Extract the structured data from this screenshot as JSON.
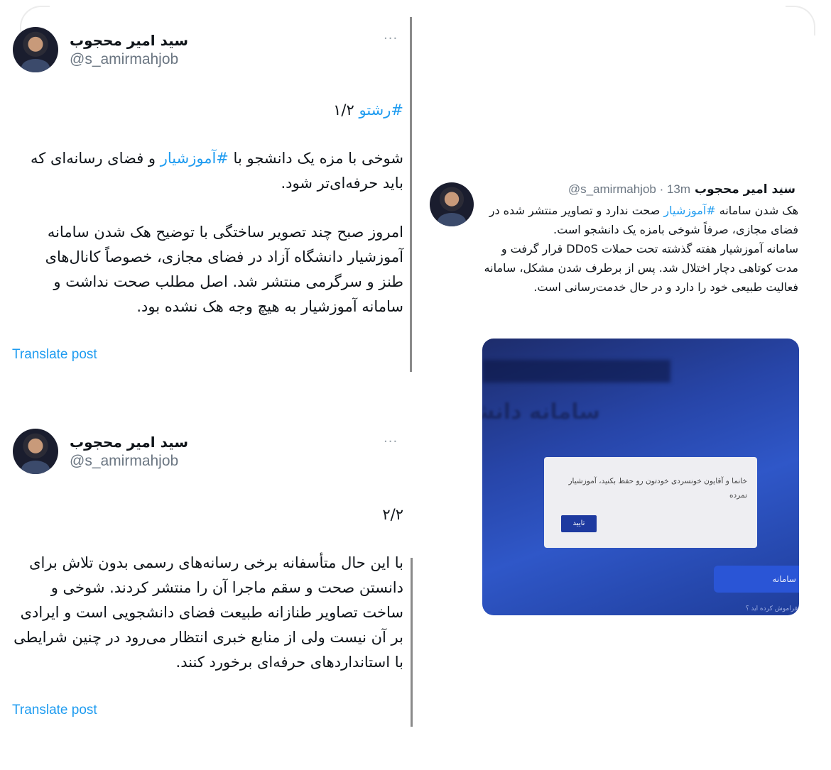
{
  "tweets": [
    {
      "display_name": "سید امیر محجوب",
      "handle": "@s_amirmahjob",
      "more": "···",
      "thread": "۱/۲",
      "hashtag_thread": "#رشتو",
      "p1_before": "شوخی با مزه یک دانشجو با ",
      "p1_hashtag": "#آموزشیار",
      "p1_after": " و فضای رسانه‌ای که باید حرفه‌ای‌تر شود.",
      "p2": "امروز صبح چند تصویر ساختگی با توضیح هک شدن سامانه آموزشیار دانشگاه آزاد در فضای مجازی، خصوصاً کانال‌های طنز و سرگرمی منتشر شد. اصل مطلب صحت نداشت و سامانه آموزشیار به هیچ وجه هک نشده بود.",
      "translate": "Translate post"
    },
    {
      "display_name": "سید امیر محجوب",
      "handle": "@s_amirmahjob",
      "more": "···",
      "thread": "۲/۲",
      "body": "با این حال متأسفانه برخی رسانه‌های رسمی بدون تلاش برای دانستن صحت و سقم ماجرا آن را منتشر کردند. شوخی و ساخت تصاویر طنازانه طبیعت فضای دانشجویی است و ایرادی بر آن نیست ولی از منابع خبری انتظار می‌رود در چنین شرایطی با استانداردهای حرفه‌ای برخورد کنند.",
      "translate": "Translate post"
    }
  ],
  "retweet": {
    "display_name": "سید امیر محجوب",
    "handle_time": "@s_amirmahjob · 13m",
    "more": "···",
    "p1_before": "هک شدن سامانه ",
    "p1_hashtag": "#آموزشیار",
    "p1_after": " صحت ندارد و تصاویر منتشر شده در فضای مجازی، صرفاً شوخی بامزه یک دانشجو است.",
    "p2": "سامانه آموزشیار هفته گذشته تحت حملات DDoS قرار گرفت و مدت کوتاهی دچار اختلال شد. پس از برطرف شدن مشکل، سامانه فعالیت طبیعی خود را دارد و در حال خدمت‌رسانی است.",
    "image": {
      "title": "سامانه دانشجو",
      "dialog_message": "خانما و آقایون خونسردی خودتون رو حفظ بکنید، آموزشیار نمرده",
      "confirm_label": "تایید",
      "login_label": "سامانه",
      "forgot_label": "فراموش کرده اید ؟"
    }
  },
  "colors": {
    "link": "#1d9bf0",
    "text": "#0f1419",
    "muted": "#6b7682"
  }
}
